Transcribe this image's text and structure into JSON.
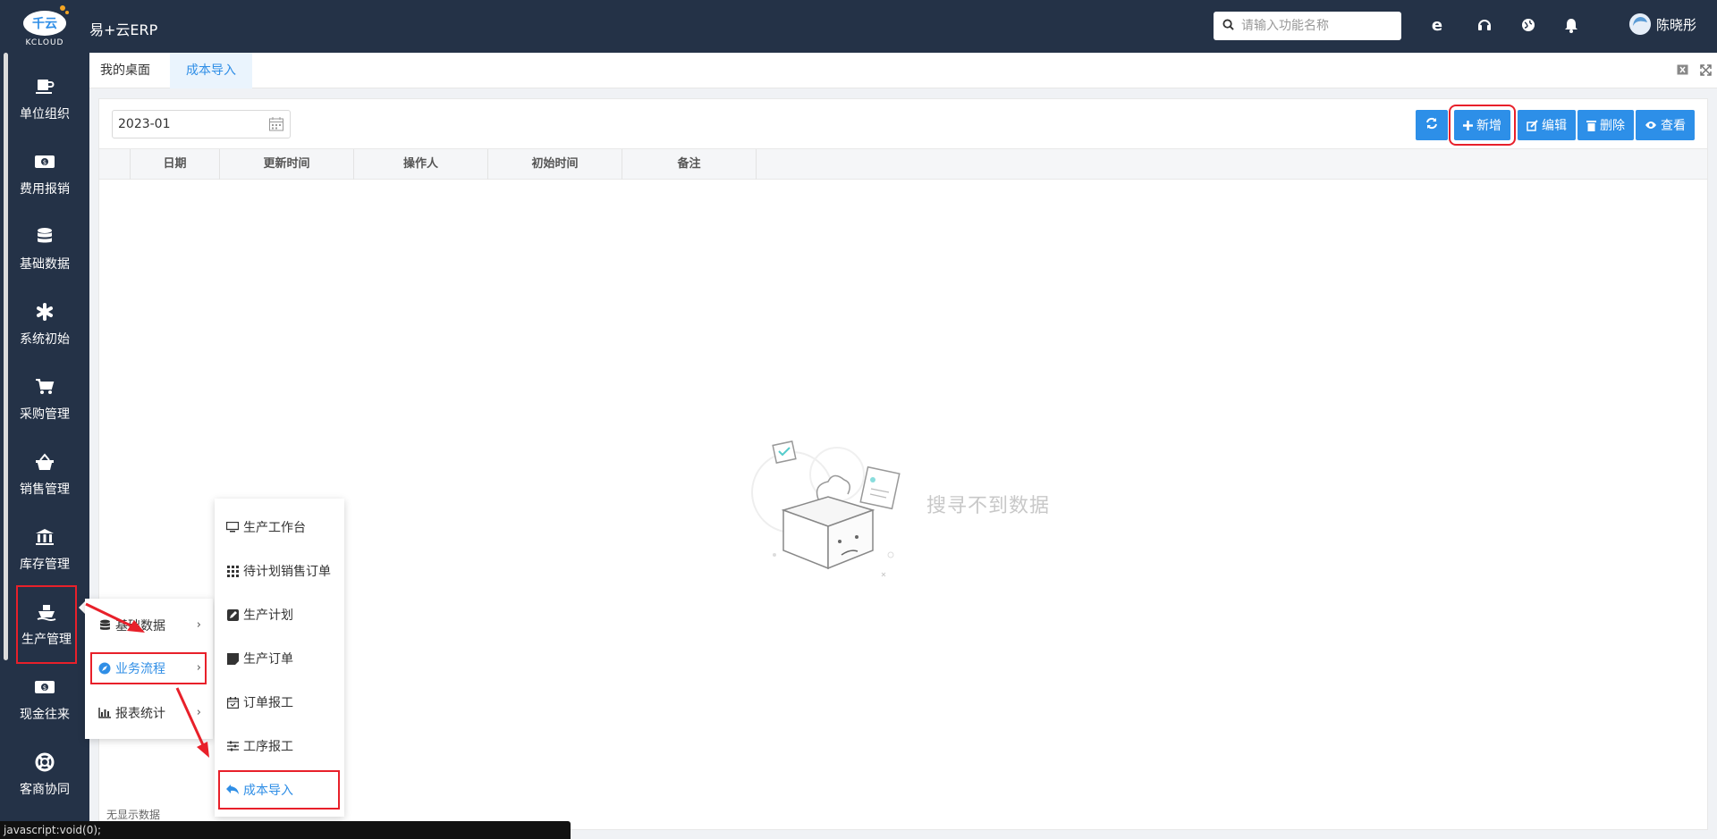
{
  "app": {
    "logo_text": "千云",
    "logo_sub": "KCLOUD",
    "title": "易+云ERP",
    "search_placeholder": "请输入功能名称",
    "user_name": "陈晓彤"
  },
  "sidebar": {
    "items": [
      {
        "label": "单位组织",
        "icon": "cup-icon"
      },
      {
        "label": "费用报销",
        "icon": "money-icon"
      },
      {
        "label": "基础数据",
        "icon": "database-icon"
      },
      {
        "label": "系统初始",
        "icon": "asterisk-icon"
      },
      {
        "label": "采购管理",
        "icon": "cart-icon"
      },
      {
        "label": "销售管理",
        "icon": "basket-icon"
      },
      {
        "label": "库存管理",
        "icon": "bank-icon"
      },
      {
        "label": "生产管理",
        "icon": "ship-icon"
      },
      {
        "label": "现金往来",
        "icon": "money-icon"
      },
      {
        "label": "客商协同",
        "icon": "lifebuoy-icon"
      }
    ]
  },
  "tabs": [
    {
      "label": "我的桌面"
    },
    {
      "label": "成本导入"
    }
  ],
  "toolbar": {
    "date_value": "2023-01",
    "add_label": "新增",
    "edit_label": "编辑",
    "delete_label": "删除",
    "view_label": "查看"
  },
  "table": {
    "columns": [
      "日期",
      "更新时间",
      "操作人",
      "初始时间",
      "备注"
    ],
    "empty_text": "搜寻不到数据",
    "footer_text": "无显示数据"
  },
  "menu_level1": [
    {
      "label": "基础数据",
      "icon": "database-icon"
    },
    {
      "label": "业务流程",
      "icon": "compass-icon"
    },
    {
      "label": "报表统计",
      "icon": "bar-chart-icon"
    }
  ],
  "menu_level2": [
    {
      "label": "生产工作台",
      "icon": "monitor-icon"
    },
    {
      "label": "待计划销售订单",
      "icon": "grid-icon"
    },
    {
      "label": "生产计划",
      "icon": "edit-icon"
    },
    {
      "label": "生产订单",
      "icon": "note-icon"
    },
    {
      "label": "订单报工",
      "icon": "calendar-icon"
    },
    {
      "label": "工序报工",
      "icon": "sliders-icon"
    },
    {
      "label": "成本导入",
      "icon": "reply-icon"
    }
  ],
  "status_bar": "javascript:void(0);",
  "colors": {
    "nav_bg": "#243247",
    "accent": "#2d8fe8",
    "highlight": "#e8202a"
  }
}
